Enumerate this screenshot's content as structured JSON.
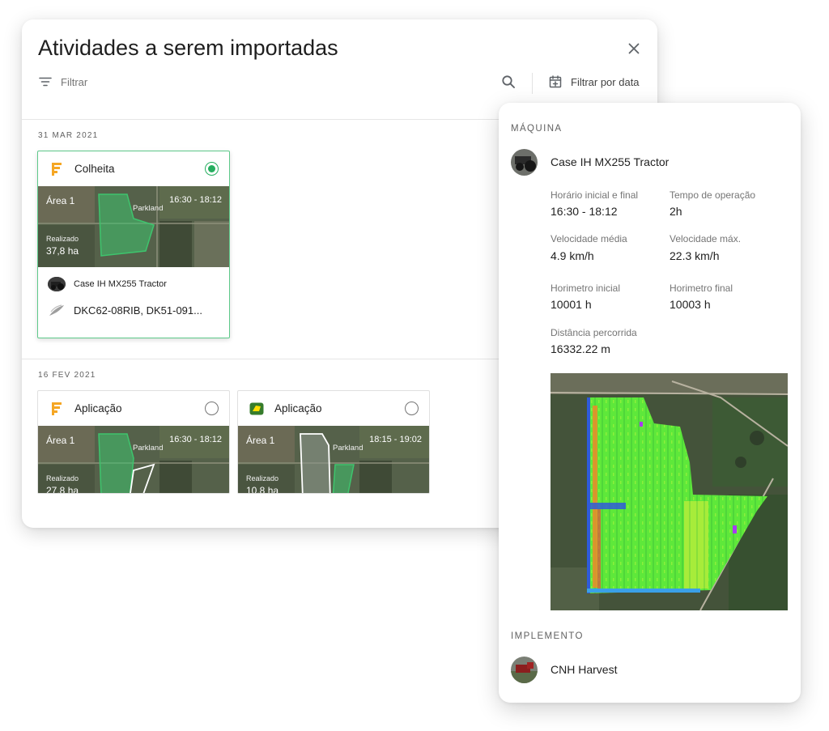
{
  "modal": {
    "title": "Atividades a serem importadas",
    "filter_label": "Filtrar",
    "date_filter_label": "Filtrar por data",
    "icons": {
      "close": "close-icon",
      "filter": "filter-list-icon",
      "search": "search-icon",
      "date": "calendar-plus-icon"
    }
  },
  "groups": [
    {
      "date": "31 MAR 2021",
      "activities": [
        {
          "operation": "Colheita",
          "operation_icon": "fuelling-logo-icon",
          "selected": true,
          "area": "Área 1",
          "time_range": "16:30 - 18:12",
          "place": "Parkland",
          "realizado_label": "Realizado",
          "realizado_value": "37,8 ha",
          "machine": "Case IH MX255 Tractor",
          "seeds": "DKC62-08RIB, DK51-091..."
        }
      ]
    },
    {
      "date": "16 FEV 2021",
      "activities": [
        {
          "operation": "Aplicação",
          "operation_icon": "fuelling-logo-icon",
          "selected": false,
          "area": "Área 1",
          "time_range": "16:30 - 18:12",
          "place": "Parkland",
          "realizado_label": "Realizado",
          "realizado_value": "27,8 ha"
        },
        {
          "operation": "Aplicação",
          "operation_icon": "john-deere-logo-icon",
          "selected": false,
          "area": "Área 1",
          "time_range": "18:15 - 19:02",
          "place": "Parkland",
          "realizado_label": "Realizado",
          "realizado_value": "10,8 ha"
        }
      ]
    }
  ],
  "panel": {
    "machine_section": "MÁQUINA",
    "machine_name": "Case IH MX255 Tractor",
    "stats": {
      "start_end_label": "Horário inicial e final",
      "start_end_value": "16:30 - 18:12",
      "op_time_label": "Tempo de operação",
      "op_time_value": "2h",
      "avg_speed_label": "Velocidade média",
      "avg_speed_value": "4.9 km/h",
      "max_speed_label": "Velocidade máx.",
      "max_speed_value": "22.3 km/h",
      "hour_start_label": "Horimetro inicial",
      "hour_start_value": "10001 h",
      "hour_end_label": "Horimetro final",
      "hour_end_value": "10003 h",
      "distance_label": "Distância percorrida",
      "distance_value": "16332.22 m"
    },
    "implement_section": "IMPLEMENTO",
    "implement_name": "CNH Harvest"
  },
  "colors": {
    "selected_green": "#27ae60",
    "field_green": "#3ec46d",
    "fuelling_orange": "#f5a623",
    "john_deere_green": "#367c2b",
    "john_deere_yellow": "#ffde00"
  }
}
